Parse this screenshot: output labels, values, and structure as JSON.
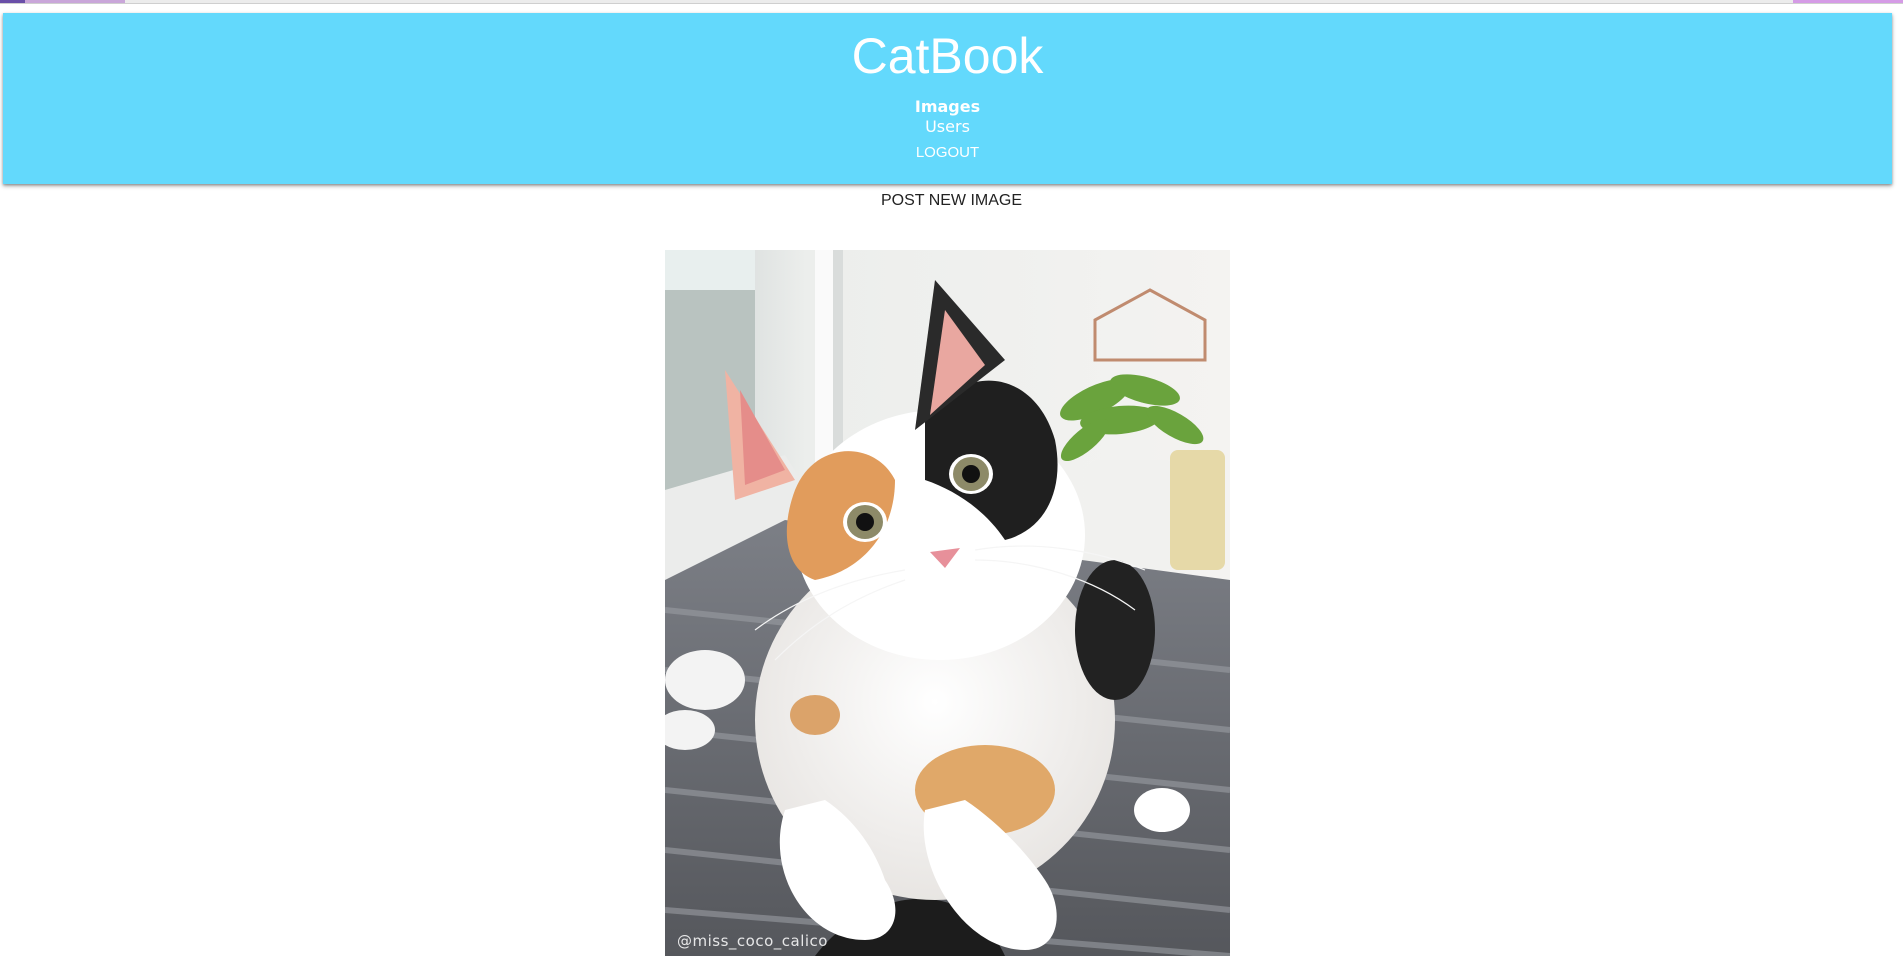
{
  "app": {
    "title": "CatBook",
    "brand_color": "#63d9fc"
  },
  "nav": {
    "items": [
      {
        "label": "Images",
        "active": true
      },
      {
        "label": "Users",
        "active": false
      }
    ],
    "logout_label": "LOGOUT"
  },
  "main": {
    "post_button_label": "POST NEW IMAGE",
    "feed": [
      {
        "image_subject": "calico kitten sitting on a grey blanket",
        "watermark": "@miss_coco_calico"
      }
    ]
  }
}
